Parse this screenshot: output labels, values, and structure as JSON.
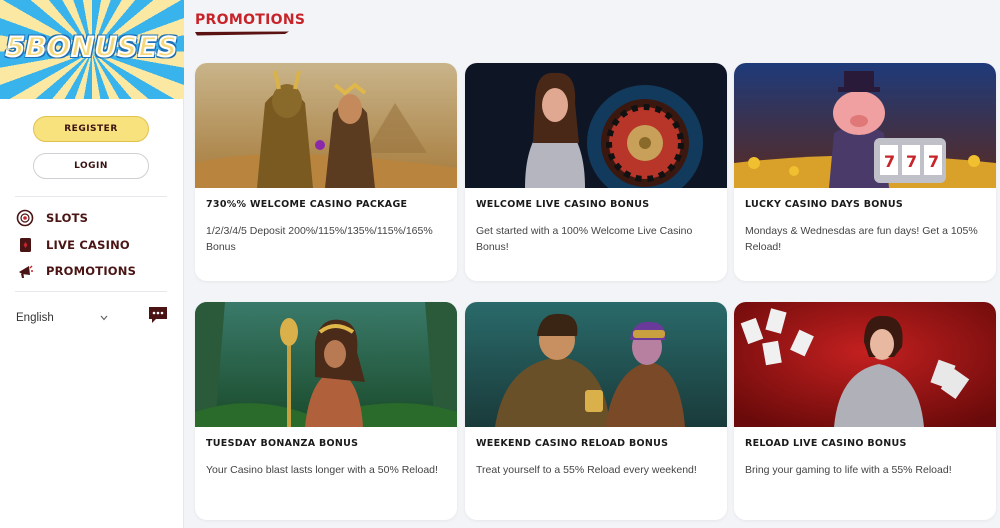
{
  "sidebar": {
    "logo_text": "5BONUSES",
    "register_label": "REGISTER",
    "login_label": "LOGIN",
    "nav": [
      {
        "label": "SLOTS",
        "icon": "slot-chip-icon"
      },
      {
        "label": "LIVE CASINO",
        "icon": "playing-card-icon"
      },
      {
        "label": "PROMOTIONS",
        "icon": "megaphone-icon"
      }
    ],
    "language": "English"
  },
  "main": {
    "title": "PROMOTIONS",
    "promotions": [
      {
        "title": "730%% WELCOME CASINO PACKAGE",
        "description": "1/2/3/4/5 Deposit 200%/115%/135%/115%/165% Bonus"
      },
      {
        "title": "WELCOME LIVE CASINO BONUS",
        "description": "Get started with a 100% Welcome Live Casino Bonus!"
      },
      {
        "title": "LUCKY CASINO DAYS BONUS",
        "description": "Mondays & Wednesdas are fun days! Get a 105% Reload!"
      },
      {
        "title": "TUESDAY BONANZA BONUS",
        "description": "Your Casino blast lasts longer with a 50% Reload!"
      },
      {
        "title": "WEEKEND CASINO RELOAD BONUS",
        "description": "Treat yourself to a 55% Reload every weekend!"
      },
      {
        "title": "RELOAD LIVE CASINO BONUS",
        "description": "Bring your gaming to life with a 55% Reload!"
      }
    ]
  },
  "colors": {
    "accent_red": "#c7242a",
    "nav_text": "#4a1414",
    "register_yellow": "#f8e27e",
    "page_bg": "#f3f4f7"
  }
}
